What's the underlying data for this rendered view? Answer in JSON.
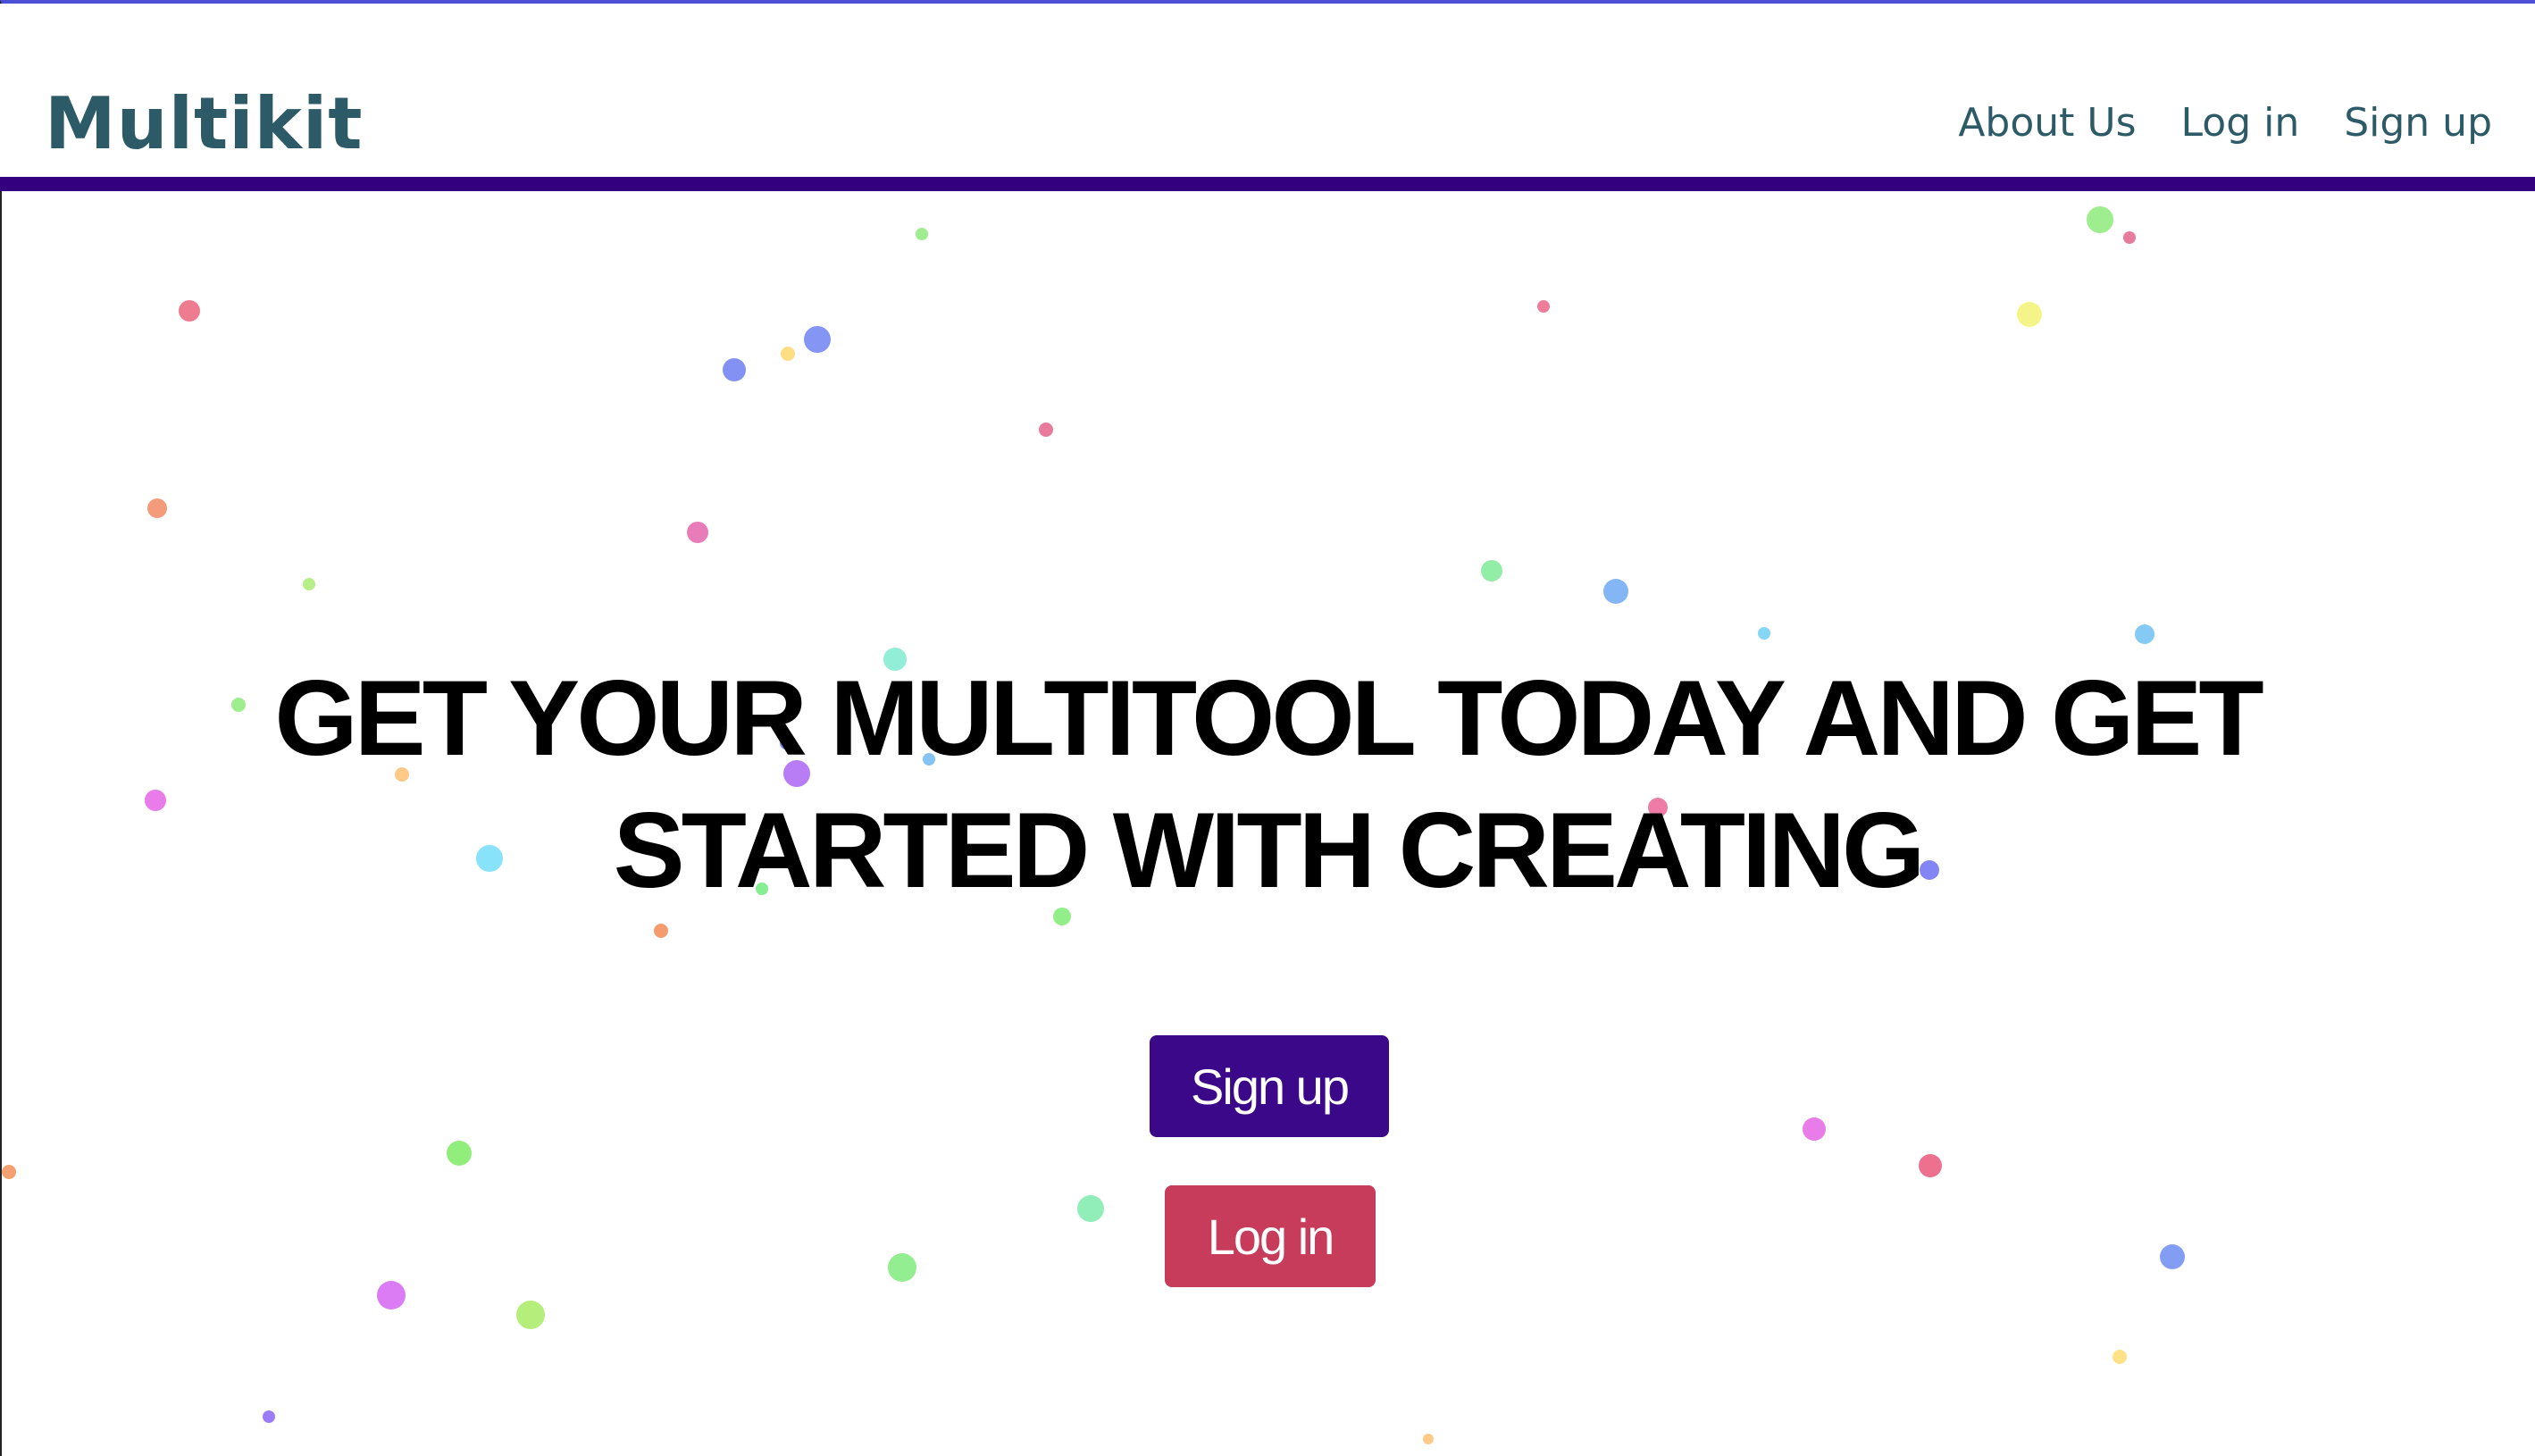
{
  "header": {
    "logo": "Multikit",
    "nav": [
      {
        "label": "About Us"
      },
      {
        "label": "Log in"
      },
      {
        "label": "Sign up"
      }
    ]
  },
  "hero": {
    "title_line1": "GET YOUR MULTITOOL TODAY AND GET",
    "title_line2": "STARTED WITH CREATING",
    "signup_label": "Sign up",
    "login_label": "Log in"
  },
  "colors": {
    "accent": "#330080",
    "logo": "#2c5b67",
    "signup_button": "#3a0888",
    "login_button": "#c73c5a"
  }
}
